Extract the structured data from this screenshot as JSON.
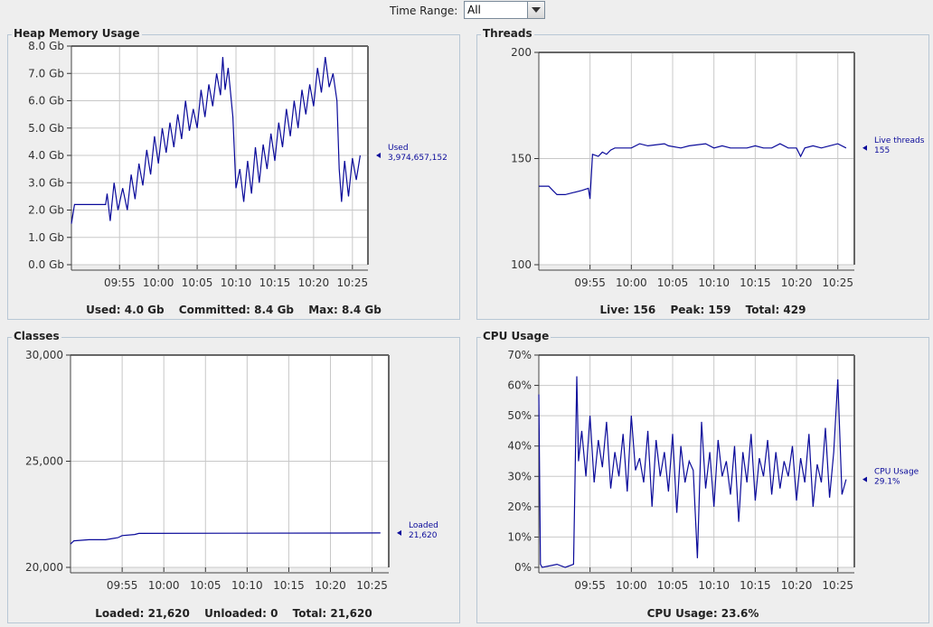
{
  "time_range": {
    "label": "Time Range:",
    "value": "All"
  },
  "panels": {
    "heap": {
      "title": "Heap Memory Usage",
      "summary": [
        "Used: 4.0 Gb",
        "Committed: 8.4 Gb",
        "Max: 8.4 Gb"
      ],
      "marker": [
        "Used",
        "3,974,657,152"
      ]
    },
    "threads": {
      "title": "Threads",
      "summary": [
        "Live: 156",
        "Peak: 159",
        "Total: 429"
      ],
      "marker": [
        "Live threads",
        "155"
      ]
    },
    "classes": {
      "title": "Classes",
      "summary": [
        "Loaded: 21,620",
        "Unloaded: 0",
        "Total: 21,620"
      ],
      "marker": [
        "Loaded",
        "21,620"
      ]
    },
    "cpu": {
      "title": "CPU Usage",
      "summary": [
        "CPU Usage: 23.6%"
      ],
      "marker": [
        "CPU Usage",
        "29.1%"
      ]
    }
  },
  "colors": {
    "line": "#0a0a9a",
    "plot_bg": "#ffffff",
    "grid": "#c8c8c8"
  },
  "chart_data": [
    {
      "id": "heap",
      "type": "line",
      "title": "Heap Memory Usage",
      "x_unit": "minutes since 09:50",
      "xlim": [
        -1.2,
        37.0
      ],
      "x_ticks": [
        "09:55",
        "10:00",
        "10:05",
        "10:10",
        "10:15",
        "10:20",
        "10:25"
      ],
      "ylim": [
        0,
        8
      ],
      "y_ticks": [
        "0.0 Gb",
        "1.0 Gb",
        "2.0 Gb",
        "3.0 Gb",
        "4.0 Gb",
        "5.0 Gb",
        "6.0 Gb",
        "7.0 Gb",
        "8.0 Gb"
      ],
      "series": [
        {
          "name": "Used",
          "x": [
            -1.2,
            -0.8,
            3.2,
            3.4,
            3.8,
            4.3,
            4.8,
            5.4,
            6.0,
            6.5,
            7.0,
            7.5,
            8.0,
            8.5,
            9.0,
            9.5,
            10.0,
            10.5,
            11.0,
            11.5,
            12.0,
            12.5,
            13.0,
            13.5,
            14.0,
            14.5,
            15.0,
            15.5,
            16.0,
            16.5,
            17.0,
            17.5,
            18.0,
            18.3,
            18.6,
            19.0,
            19.3,
            19.6,
            20.0,
            20.5,
            21.0,
            21.5,
            22.0,
            22.5,
            23.0,
            23.5,
            24.0,
            24.5,
            25.0,
            25.5,
            26.0,
            26.5,
            27.0,
            27.5,
            28.0,
            28.5,
            29.0,
            29.5,
            30.0,
            30.5,
            31.0,
            31.5,
            32.0,
            32.5,
            33.0,
            33.3,
            33.6,
            34.0,
            34.5,
            35.0,
            35.5,
            36.0
          ],
          "y": [
            1.5,
            2.2,
            2.2,
            2.6,
            1.6,
            3.0,
            2.0,
            2.8,
            2.0,
            3.3,
            2.4,
            3.7,
            2.9,
            4.2,
            3.3,
            4.7,
            3.7,
            5.0,
            4.1,
            5.2,
            4.3,
            5.5,
            4.6,
            6.0,
            4.9,
            5.7,
            5.0,
            6.4,
            5.4,
            6.6,
            5.8,
            7.0,
            6.2,
            7.6,
            6.4,
            7.2,
            6.3,
            5.4,
            2.8,
            3.5,
            2.3,
            3.8,
            2.6,
            4.3,
            3.0,
            4.4,
            3.5,
            4.8,
            3.8,
            5.2,
            4.3,
            5.7,
            4.7,
            6.0,
            5.0,
            6.4,
            5.5,
            6.6,
            5.8,
            7.2,
            6.3,
            7.6,
            6.5,
            7.0,
            6.0,
            3.5,
            2.3,
            3.8,
            2.5,
            3.9,
            3.1,
            4.0
          ]
        }
      ]
    },
    {
      "id": "threads",
      "type": "line",
      "title": "Threads",
      "x_unit": "minutes since 09:50",
      "xlim": [
        -1.2,
        37.0
      ],
      "x_ticks": [
        "09:55",
        "10:00",
        "10:05",
        "10:10",
        "10:15",
        "10:20",
        "10:25"
      ],
      "ylim": [
        100,
        200
      ],
      "y_ticks": [
        "100",
        "150",
        "200"
      ],
      "series": [
        {
          "name": "Live threads",
          "x": [
            -1.2,
            0.0,
            0.5,
            1.0,
            2.0,
            3.0,
            4.0,
            4.8,
            5.0,
            5.3,
            6.0,
            6.5,
            7.0,
            7.5,
            8.0,
            10.0,
            11.0,
            12.0,
            14.0,
            14.5,
            16.0,
            17.0,
            19.0,
            20.0,
            21.0,
            22.0,
            23.0,
            24.0,
            25.0,
            26.0,
            27.0,
            28.0,
            29.0,
            30.0,
            30.5,
            31.0,
            32.0,
            33.0,
            34.0,
            35.0,
            36.0
          ],
          "y": [
            137,
            137,
            135,
            133,
            133,
            134,
            135,
            136,
            131,
            152,
            151,
            153,
            152,
            154,
            155,
            155,
            157,
            156,
            157,
            156,
            155,
            156,
            157,
            155,
            156,
            155,
            155,
            155,
            156,
            155,
            155,
            157,
            155,
            155,
            151,
            155,
            156,
            155,
            156,
            157,
            155
          ]
        }
      ]
    },
    {
      "id": "classes",
      "type": "line",
      "title": "Classes",
      "x_unit": "minutes since 09:50",
      "xlim": [
        -1.2,
        37.0
      ],
      "x_ticks": [
        "09:55",
        "10:00",
        "10:05",
        "10:10",
        "10:15",
        "10:20",
        "10:25"
      ],
      "ylim": [
        20000,
        30000
      ],
      "y_ticks": [
        "20,000",
        "25,000",
        "30,000"
      ],
      "series": [
        {
          "name": "Loaded",
          "x": [
            -1.2,
            -0.8,
            1.0,
            3.0,
            4.5,
            5.0,
            6.5,
            7.0,
            36.0
          ],
          "y": [
            21100,
            21250,
            21300,
            21300,
            21400,
            21500,
            21550,
            21600,
            21620
          ]
        }
      ]
    },
    {
      "id": "cpu",
      "type": "line",
      "title": "CPU Usage",
      "x_unit": "minutes since 09:50",
      "xlim": [
        -1.2,
        37.0
      ],
      "x_ticks": [
        "09:55",
        "10:00",
        "10:05",
        "10:10",
        "10:15",
        "10:20",
        "10:25"
      ],
      "ylim": [
        0,
        70
      ],
      "y_ticks": [
        "0%",
        "10%",
        "20%",
        "30%",
        "40%",
        "50%",
        "60%",
        "70%"
      ],
      "series": [
        {
          "name": "CPU Usage",
          "x": [
            -1.2,
            -1.0,
            -0.8,
            1.0,
            2.0,
            3.0,
            3.4,
            3.6,
            4.0,
            4.5,
            5.0,
            5.5,
            6.0,
            6.5,
            7.0,
            7.5,
            8.0,
            8.5,
            9.0,
            9.5,
            10.0,
            10.5,
            11.0,
            11.5,
            12.0,
            12.5,
            13.0,
            13.5,
            14.0,
            14.5,
            15.0,
            15.5,
            16.0,
            16.5,
            17.0,
            17.5,
            18.0,
            18.5,
            19.0,
            19.5,
            20.0,
            20.5,
            21.0,
            21.5,
            22.0,
            22.5,
            23.0,
            23.5,
            24.0,
            24.5,
            25.0,
            25.5,
            26.0,
            26.5,
            27.0,
            27.5,
            28.0,
            28.5,
            29.0,
            29.5,
            30.0,
            30.5,
            31.0,
            31.5,
            32.0,
            32.5,
            33.0,
            33.5,
            34.0,
            34.5,
            35.0,
            35.5,
            36.0
          ],
          "y": [
            57,
            1,
            0,
            1,
            0,
            1,
            63,
            35,
            45,
            30,
            50,
            28,
            42,
            33,
            48,
            26,
            38,
            30,
            44,
            25,
            50,
            32,
            36,
            28,
            45,
            20,
            42,
            30,
            38,
            25,
            44,
            18,
            40,
            28,
            35,
            32,
            3,
            48,
            26,
            38,
            20,
            42,
            30,
            35,
            24,
            40,
            15,
            38,
            28,
            44,
            22,
            36,
            30,
            42,
            24,
            38,
            26,
            35,
            30,
            40,
            22,
            36,
            28,
            44,
            20,
            34,
            28,
            46,
            23,
            38,
            62,
            24,
            29
          ]
        }
      ]
    }
  ]
}
